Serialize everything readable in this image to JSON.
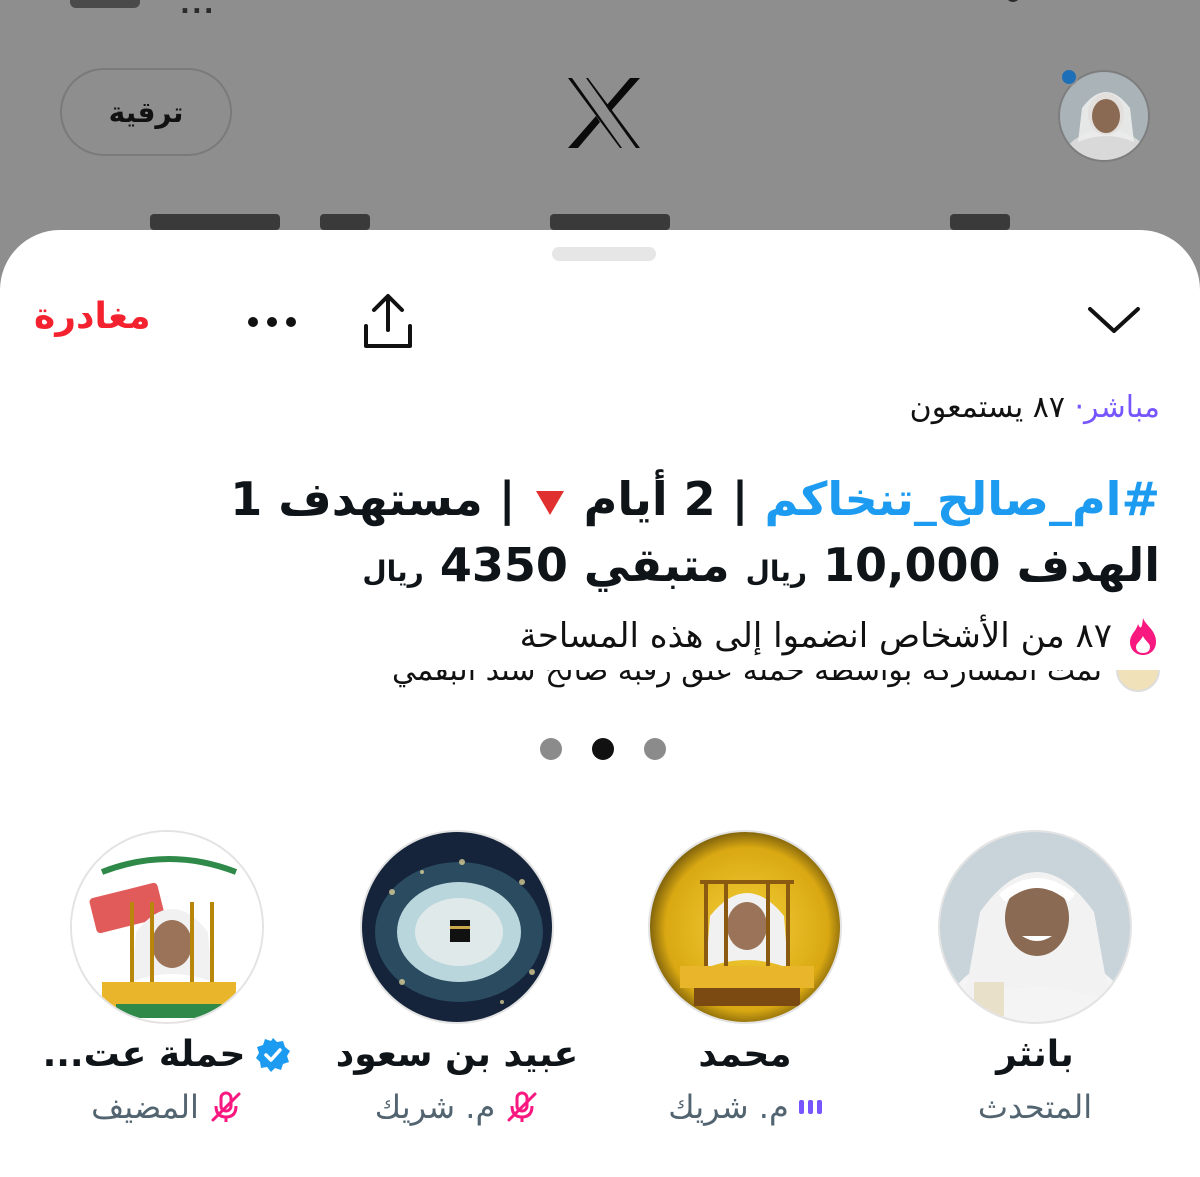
{
  "header": {
    "upgrade_label": "ترقية",
    "logo": "x-logo",
    "avatar": "profile-avatar",
    "notification_dot_color": "#1d6fb8"
  },
  "sheet": {
    "leave_label": "مغادرة",
    "leave_color": "#f4212e",
    "icons": [
      "chevron-down-icon",
      "share-icon",
      "more-icon"
    ]
  },
  "space": {
    "live_label": "مباشر·",
    "listeners_label": "٨٧ يستمعون",
    "title_hashtag": "#ام_صالح_تنخاكم",
    "title_part1": "| 2 أيام",
    "title_part2": "| مستهدف 1",
    "title_goal_label": "الهدف",
    "title_goal_amount": "10,000",
    "title_currency1": "ريال",
    "title_remaining_label": "متبقي",
    "title_remaining_amount": "4350",
    "title_currency2": "ريال",
    "joined_text": "٨٧ من الأشخاص انضموا إلى هذه المساحة",
    "shared_text": "تمت المشاركة بواسطة حملة عتق رقبة صالح سند البقمي",
    "carousel": {
      "count": 3,
      "active_index": 1
    }
  },
  "participants": [
    {
      "name": "بانثر",
      "role": "المتحدث",
      "status_icon": ""
    },
    {
      "name": "محمد",
      "role": "م. شريك",
      "status_icon": "speaking-bars-icon"
    },
    {
      "name": "عبيد بن سعود",
      "role": "م. شريك",
      "status_icon": "mic-off-icon"
    },
    {
      "name": "حملة عت...",
      "role": "المضيف",
      "status_icon": "mic-off-icon",
      "verified": true
    }
  ]
}
